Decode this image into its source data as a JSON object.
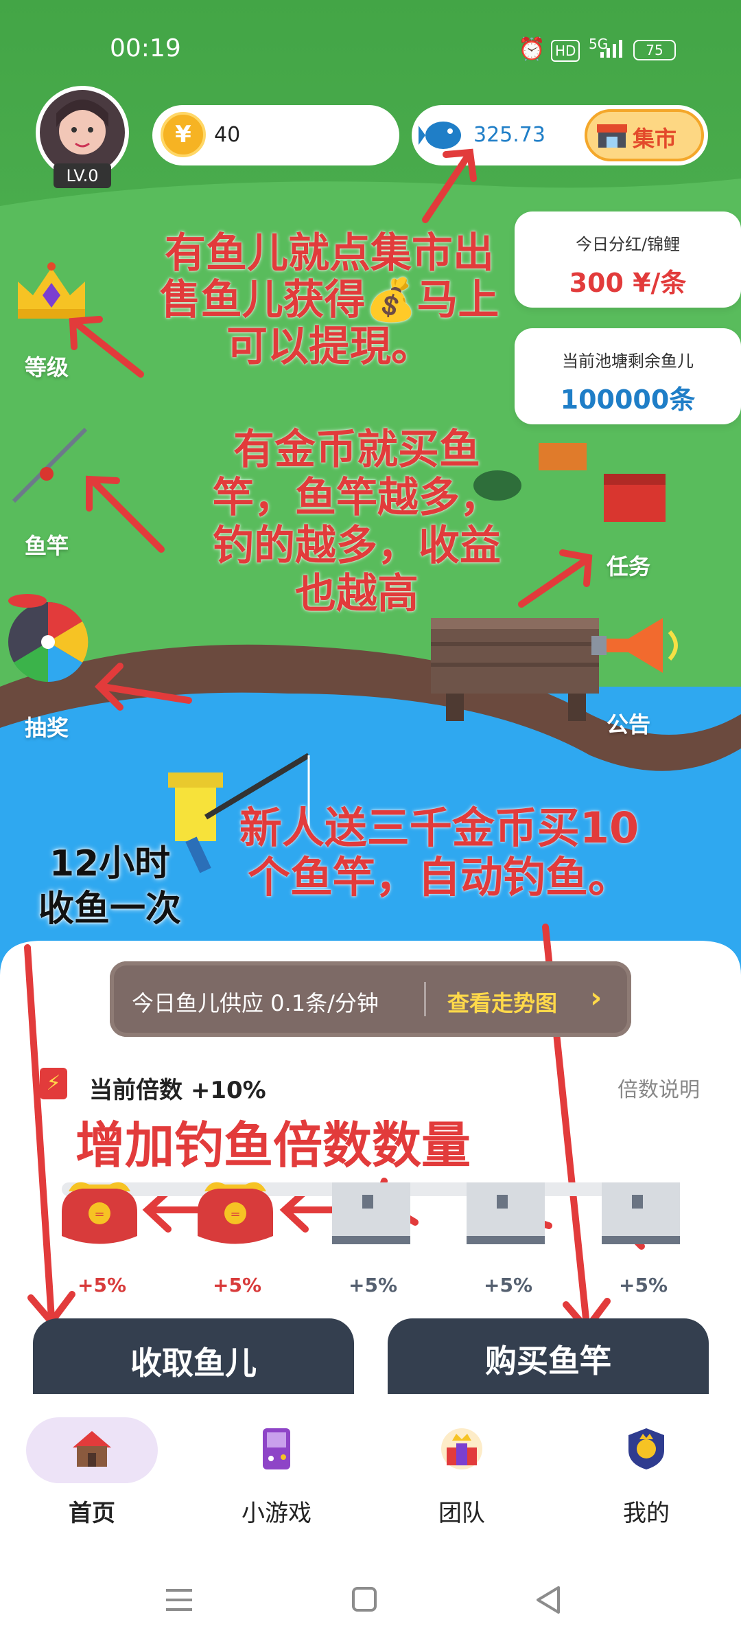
{
  "status": {
    "time": "00:19",
    "hd": "HD",
    "network": "5G",
    "battery": "75"
  },
  "user": {
    "level": "LV.0"
  },
  "coins": {
    "value": "40"
  },
  "fish": {
    "value": "325.73",
    "market_label": "集市"
  },
  "cards": {
    "dividend_title": "今日分红/锦鲤",
    "dividend_value": "300 ¥/条",
    "pond_title": "当前池塘剩余鱼儿",
    "pond_value": "100000条"
  },
  "side_menu": {
    "level": "等级",
    "rod": "鱼竿",
    "lottery": "抽奖",
    "task": "任务",
    "notice": "公告"
  },
  "annotations": {
    "market_line1": "有鱼儿就点集市出",
    "market_line2": "售鱼儿获得💰马上",
    "market_line3": "可以提現。",
    "rod_line1": "有金币就买鱼",
    "rod_line2": "竿，鱼竿越多，",
    "rod_line3": "钓的越多，收益",
    "rod_line4": "也越高",
    "newbie_line1": "新人送三千金币买10",
    "newbie_line2": "个鱼竿，自动钓鱼。",
    "collect_line1": "12小时",
    "collect_line2": "收鱼一次",
    "multiplier": "增加钓鱼倍数数量"
  },
  "supply": {
    "text": "今日鱼儿供应 0.1条/分钟",
    "trend_link": "查看走势图",
    "chevron": "›"
  },
  "multiplier": {
    "label": "当前倍数 +10%",
    "help_link": "倍数说明",
    "slots": [
      {
        "label": "+5%",
        "state": "filled",
        "color": "#D83B3B"
      },
      {
        "label": "+5%",
        "state": "filled",
        "color": "#D83B3B"
      },
      {
        "label": "+5%",
        "state": "empty",
        "color": "#556070"
      },
      {
        "label": "+5%",
        "state": "empty",
        "color": "#556070"
      },
      {
        "label": "+5%",
        "state": "empty",
        "color": "#556070"
      }
    ]
  },
  "actions": {
    "collect": "收取鱼儿",
    "buy_rod": "购买鱼竿"
  },
  "bottom_nav": {
    "home": "首页",
    "games": "小游戏",
    "team": "团队",
    "mine": "我的"
  },
  "colors": {
    "grass": "#4FB151",
    "water": "#2FA8F0",
    "dirt": "#6B4A3E",
    "accent_red": "#E23B3B",
    "fish_blue": "#1F7EC7"
  }
}
